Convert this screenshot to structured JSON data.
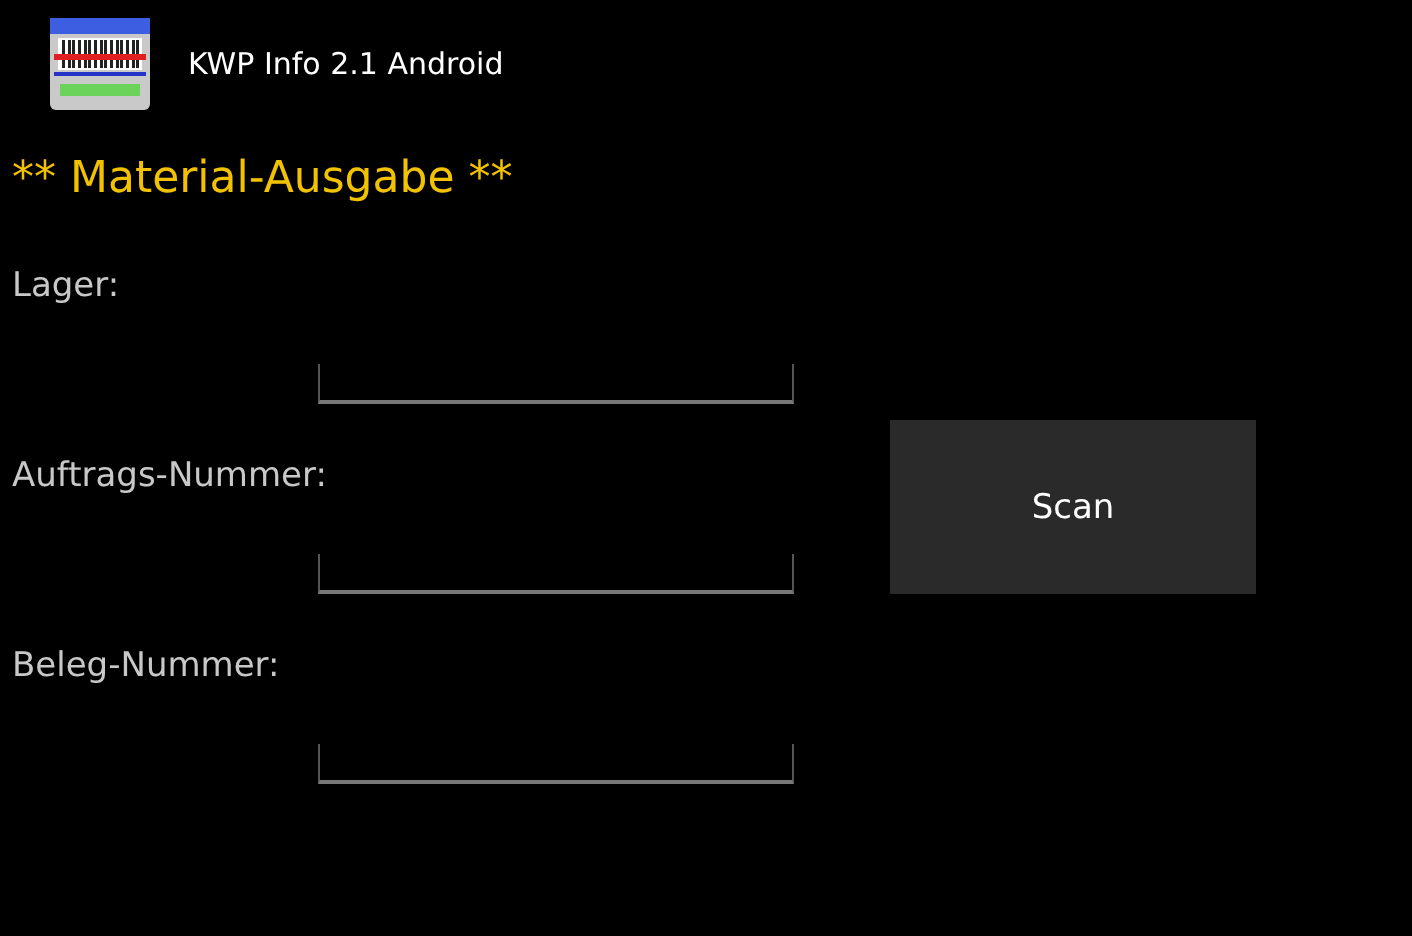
{
  "app_bar": {
    "title": "KWP Info 2.1 Android"
  },
  "heading": "** Material-Ausgabe **",
  "fields": [
    {
      "label": "Lager:"
    },
    {
      "label": "Auftrags-Nummer:"
    },
    {
      "label": "Beleg-Nummer:"
    }
  ],
  "scan_button": "Scan"
}
